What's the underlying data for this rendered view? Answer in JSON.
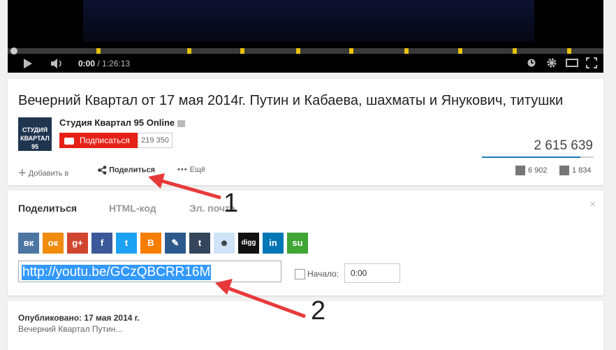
{
  "player": {
    "time_current": "0:00",
    "time_separator": " / ",
    "time_total": "1:26:13",
    "icons": [
      "play-icon",
      "volume-icon",
      "clock-icon",
      "gear-icon",
      "theater-icon",
      "fullscreen-icon"
    ]
  },
  "video": {
    "title": "Вечерний Квартал от 17 мая 2014г. Путин и Кабаева, шахматы и Янукович, титушки",
    "channel": "Студия Квартал 95 Online",
    "logo_text": "СТУДИЯ КВАРТАЛ 95",
    "subscribe_label": "Подписаться",
    "subscriber_count": "219 350",
    "views": "2 615 639",
    "like_ratio": 0.88,
    "likes": "6 902",
    "dislikes": "1 834",
    "actions": {
      "add": "Добавить в",
      "share": "Поделиться",
      "more": "Ещё"
    }
  },
  "share": {
    "tabs": [
      "Поделиться",
      "HTML-код",
      "Эл. почта"
    ],
    "close_label": "×",
    "services": [
      {
        "name": "vk",
        "glyph": "вк",
        "color": "#4d76a1"
      },
      {
        "name": "odnoklassniki",
        "glyph": "ок",
        "color": "#f18b0c"
      },
      {
        "name": "google-plus",
        "glyph": "g+",
        "color": "#d1452f"
      },
      {
        "name": "facebook",
        "glyph": "f",
        "color": "#3b5998"
      },
      {
        "name": "twitter",
        "glyph": "t",
        "color": "#1da1f2"
      },
      {
        "name": "blogger",
        "glyph": "B",
        "color": "#f57d00"
      },
      {
        "name": "livejournal",
        "glyph": "✎",
        "color": "#2d5a8c"
      },
      {
        "name": "tumblr",
        "glyph": "t",
        "color": "#35465c"
      },
      {
        "name": "reddit",
        "glyph": "☻",
        "color": "#cee3f8"
      },
      {
        "name": "digg",
        "glyph": "digg",
        "color": "#111111"
      },
      {
        "name": "linkedin",
        "glyph": "in",
        "color": "#0077b5"
      },
      {
        "name": "stumbleupon",
        "glyph": "su",
        "color": "#3fa535"
      }
    ],
    "url": "http://youtu.be/GCzQBCRR16M",
    "start_label": "Начало:",
    "start_value": "0:00"
  },
  "description": {
    "published": "Опубликовано: 17 мая 2014 г.",
    "first_line": "Вечерний Квартал Путин..."
  },
  "annotations": {
    "one": "1",
    "two": "2",
    "color": "#e8393a"
  },
  "colors": {
    "accent": "#e62117",
    "link": "#167ac6"
  }
}
